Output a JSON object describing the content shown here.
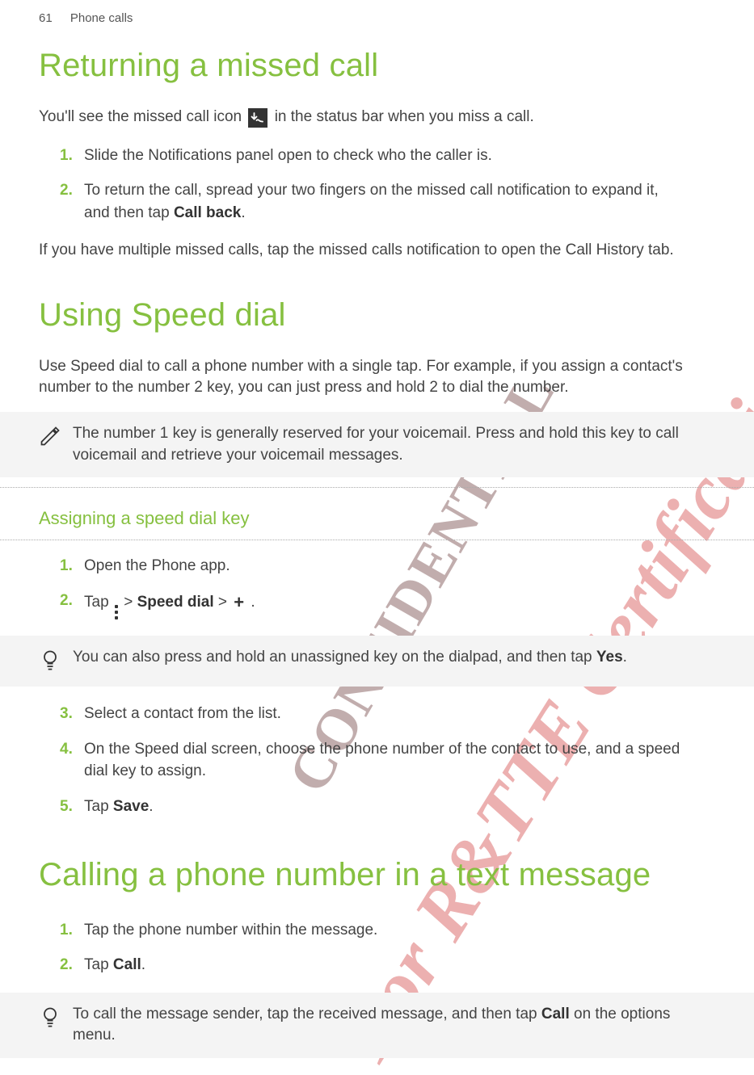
{
  "header": {
    "page_num": "61",
    "section": "Phone calls"
  },
  "watermarks": {
    "w1": "For R&TTE Certification only",
    "w2": "CONFIDENTIAL"
  },
  "s1": {
    "title": "Returning a missed call",
    "intro_a": "You'll see the missed call icon ",
    "intro_b": " in the status bar when you miss a call.",
    "steps": [
      "Slide the Notifications panel open to check who the caller is.",
      "To return the call, spread your two fingers on the missed call notification to expand it, and then tap "
    ],
    "step2_bold": "Call back",
    "outro": "If you have multiple missed calls, tap the missed calls notification to open the Call History tab."
  },
  "s2": {
    "title": "Using Speed dial",
    "intro": "Use Speed dial to call a phone number with a single tap. For example, if you assign a contact's number to the number 2 key, you can just press and hold 2 to dial the number.",
    "note": "The number 1 key is generally reserved for your voicemail. Press and hold this key to call voicemail and retrieve your voicemail messages.",
    "subhead": "Assigning a speed dial key",
    "steps_a": [
      "Open the Phone app."
    ],
    "step2_a": "Tap ",
    "step2_b": " > ",
    "step2_bold": "Speed dial",
    "step2_c": " > ",
    "tip_a": "You can also press and hold an unassigned key on the dialpad, and then tap ",
    "tip_bold": "Yes",
    "steps_b": [
      "Select a contact from the list.",
      "On the Speed dial screen, choose the phone number of the contact to use, and a speed dial key to assign.",
      "Tap "
    ],
    "step5_bold": "Save"
  },
  "s3": {
    "title": "Calling a phone number in a text message",
    "steps": [
      "Tap the phone number within the message.",
      "Tap "
    ],
    "step2_bold": "Call",
    "tip_a": "To call the message sender, tap the received message, and then tap ",
    "tip_bold": "Call",
    "tip_b": " on the options menu."
  }
}
